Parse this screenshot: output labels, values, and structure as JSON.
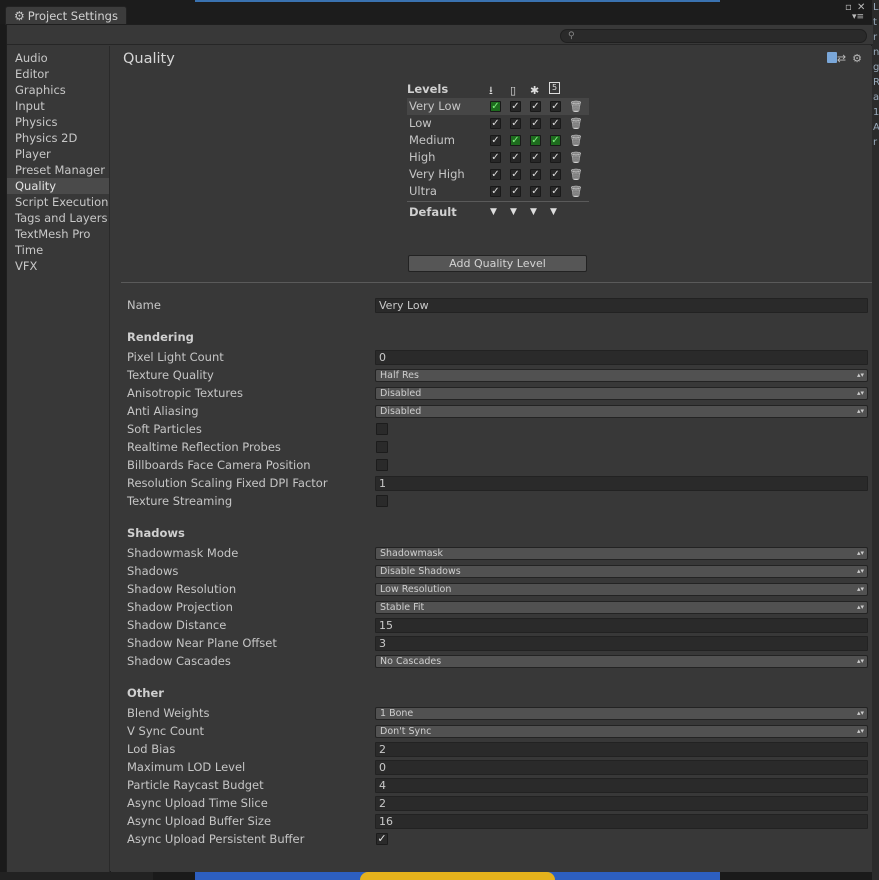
{
  "window": {
    "tab_title": "Project Settings"
  },
  "sidebar": {
    "items": [
      {
        "label": "Audio"
      },
      {
        "label": "Editor"
      },
      {
        "label": "Graphics"
      },
      {
        "label": "Input"
      },
      {
        "label": "Physics"
      },
      {
        "label": "Physics 2D"
      },
      {
        "label": "Player"
      },
      {
        "label": "Preset Manager"
      },
      {
        "label": "Quality"
      },
      {
        "label": "Script Execution Order"
      },
      {
        "label": "Tags and Layers"
      },
      {
        "label": "TextMesh Pro"
      },
      {
        "label": "Time"
      },
      {
        "label": "VFX"
      }
    ],
    "active": "Quality"
  },
  "content": {
    "title": "Quality",
    "levels": {
      "header": "Levels",
      "platform_icons": [
        "download-icon",
        "mobile-icon",
        "android-icon",
        "html5-icon"
      ],
      "rows": [
        {
          "name": "Very Low",
          "checks": [
            "green",
            "on",
            "on",
            "on"
          ]
        },
        {
          "name": "Low",
          "checks": [
            "on",
            "on",
            "on",
            "on"
          ]
        },
        {
          "name": "Medium",
          "checks": [
            "on",
            "green",
            "green",
            "green"
          ]
        },
        {
          "name": "High",
          "checks": [
            "on",
            "on",
            "on",
            "on"
          ]
        },
        {
          "name": "Very High",
          "checks": [
            "on",
            "on",
            "on",
            "on"
          ]
        },
        {
          "name": "Ultra",
          "checks": [
            "on",
            "on",
            "on",
            "on"
          ]
        }
      ],
      "default_label": "Default",
      "add_button": "Add Quality Level"
    },
    "name_label": "Name",
    "name_value": "Very Low",
    "rendering": {
      "header": "Rendering",
      "pixel_light_count": {
        "label": "Pixel Light Count",
        "value": "0"
      },
      "texture_quality": {
        "label": "Texture Quality",
        "value": "Half Res"
      },
      "anisotropic": {
        "label": "Anisotropic Textures",
        "value": "Disabled"
      },
      "anti_aliasing": {
        "label": "Anti Aliasing",
        "value": "Disabled"
      },
      "soft_particles": {
        "label": "Soft Particles",
        "checked": false
      },
      "realtime_probes": {
        "label": "Realtime Reflection Probes",
        "checked": false
      },
      "billboards": {
        "label": "Billboards Face Camera Position",
        "checked": false
      },
      "dpi_factor": {
        "label": "Resolution Scaling Fixed DPI Factor",
        "value": "1"
      },
      "texture_streaming": {
        "label": "Texture Streaming",
        "checked": false
      }
    },
    "shadows": {
      "header": "Shadows",
      "shadowmask_mode": {
        "label": "Shadowmask Mode",
        "value": "Shadowmask"
      },
      "shadows": {
        "label": "Shadows",
        "value": "Disable Shadows"
      },
      "resolution": {
        "label": "Shadow Resolution",
        "value": "Low Resolution"
      },
      "projection": {
        "label": "Shadow Projection",
        "value": "Stable Fit"
      },
      "distance": {
        "label": "Shadow Distance",
        "value": "15"
      },
      "near_plane": {
        "label": "Shadow Near Plane Offset",
        "value": "3"
      },
      "cascades": {
        "label": "Shadow Cascades",
        "value": "No Cascades"
      }
    },
    "other": {
      "header": "Other",
      "blend_weights": {
        "label": "Blend Weights",
        "value": "1 Bone"
      },
      "vsync": {
        "label": "V Sync Count",
        "value": "Don't Sync"
      },
      "lod_bias": {
        "label": "Lod Bias",
        "value": "2"
      },
      "max_lod": {
        "label": "Maximum LOD Level",
        "value": "0"
      },
      "raycast_budget": {
        "label": "Particle Raycast Budget",
        "value": "4"
      },
      "upload_time_slice": {
        "label": "Async Upload Time Slice",
        "value": "2"
      },
      "upload_buffer_size": {
        "label": "Async Upload Buffer Size",
        "value": "16"
      },
      "persistent_buffer": {
        "label": "Async Upload Persistent Buffer",
        "checked": true
      }
    }
  },
  "colors": {
    "check_green": "#1e6b1e",
    "panel": "#383838",
    "field": "#2a2a2a"
  }
}
